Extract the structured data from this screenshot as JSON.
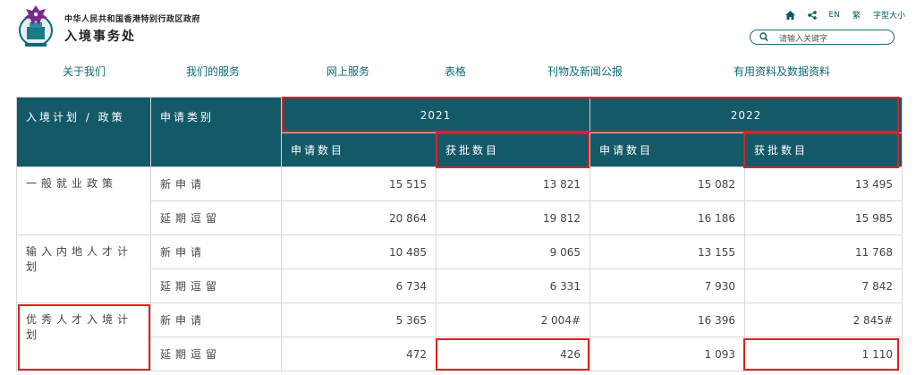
{
  "header": {
    "gov_name": "中华人民共和国香港特别行政区政府",
    "dept_name": "入境事务处",
    "utility": {
      "lang_en": "EN",
      "lang_trad": "繁",
      "font_size": "字型大小"
    },
    "search_placeholder": "请输入关键字"
  },
  "nav": [
    "关于我们",
    "我们的服务",
    "网上服务",
    "表格",
    "刊物及新闻公报",
    "有用资料及数据资料"
  ],
  "table": {
    "col_scheme": "入境计划 / 政策",
    "col_type": "申请类别",
    "years": [
      "2021",
      "2022"
    ],
    "sub_headers": [
      "申请数目",
      "获批数目",
      "申请数目",
      "获批数目"
    ],
    "rows": [
      {
        "scheme": "一般就业政策",
        "type": "新申请",
        "values": [
          "15 515",
          "13 821",
          "15 082",
          "13 495"
        ]
      },
      {
        "scheme": "",
        "type": "延期逗留",
        "values": [
          "20 864",
          "19 812",
          "16 186",
          "15 985"
        ]
      },
      {
        "scheme": "输入内地人才计划",
        "type": "新申请",
        "values": [
          "10 485",
          "9 065",
          "13 155",
          "11 768"
        ]
      },
      {
        "scheme": "",
        "type": "延期逗留",
        "values": [
          "6 734",
          "6 331",
          "7 930",
          "7 842"
        ]
      },
      {
        "scheme": "优秀人才入境计划",
        "type": "新申请",
        "values": [
          "5 365",
          "2 004#",
          "16 396",
          "2 845#"
        ]
      },
      {
        "scheme": "",
        "type": "延期逗留",
        "values": [
          "472",
          "426",
          "1 093",
          "1 110"
        ]
      }
    ]
  },
  "colors": {
    "header_bg": "#145968",
    "accent": "#0a6a75",
    "highlight": "#e02020"
  }
}
